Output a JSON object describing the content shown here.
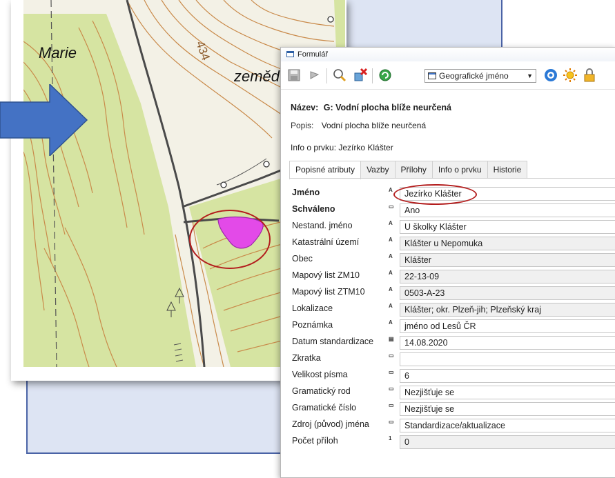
{
  "map": {
    "labels": {
      "place_name": "Marie",
      "land_use": "zeměd.",
      "contour_value": "434"
    }
  },
  "form": {
    "window_title": "Formulář",
    "toolbar": {
      "layer_select_value": "Geografické jméno",
      "icons": [
        "save-icon",
        "undo-icon",
        "search-icon",
        "delete-icon",
        "refresh-icon",
        "layer-icon",
        "target-icon",
        "sun-icon",
        "lock-icon"
      ]
    },
    "nazev": {
      "label": "Název:",
      "value": "G: Vodní plocha blíže neurčená"
    },
    "popis": {
      "label": "Popis:",
      "value": "Vodní plocha blíže neurčená"
    },
    "info": {
      "text": "Info o prvku: Jezírko Klášter"
    },
    "tabs": [
      "Popisné atributy",
      "Vazby",
      "Přílohy",
      "Info o prvku",
      "Historie"
    ],
    "attributes": [
      {
        "label": "Jméno",
        "type": "A",
        "value": "Jezírko Klášter"
      },
      {
        "label": "Schváleno",
        "type": "▭",
        "value": "Ano"
      },
      {
        "label": "Nestand. jméno",
        "type": "A",
        "value": "U školky Klášter"
      },
      {
        "label": "Katastrální území",
        "type": "A",
        "value": "Klášter u Nepomuka"
      },
      {
        "label": "Obec",
        "type": "A",
        "value": "Klášter"
      },
      {
        "label": "Mapový list ZM10",
        "type": "A",
        "value": "22-13-09"
      },
      {
        "label": "Mapový list ZTM10",
        "type": "A",
        "value": "0503-A-23"
      },
      {
        "label": "Lokalizace",
        "type": "A",
        "value": "Klášter; okr. Plzeň-jih; Plzeňský kraj"
      },
      {
        "label": "Poznámka",
        "type": "A",
        "value": "jméno od Lesů ČR"
      },
      {
        "label": "Datum standardizace",
        "type": "▤",
        "value": "14.08.2020"
      },
      {
        "label": "Zkratka",
        "type": "▭",
        "value": ""
      },
      {
        "label": "Velikost písma",
        "type": "▭",
        "value": "6"
      },
      {
        "label": "Gramatický rod",
        "type": "▭",
        "value": "Nezjišťuje se"
      },
      {
        "label": "Gramatické číslo",
        "type": "▭",
        "value": "Nezjišťuje se"
      },
      {
        "label": "Zdroj (původ) jména",
        "type": "▭",
        "value": "Standardizace/aktualizace"
      },
      {
        "label": "Počet příloh",
        "type": "1",
        "value": "0"
      }
    ]
  },
  "colors": {
    "accent_border": "#4a63a6",
    "panel_bg": "#dde4f3",
    "arrow": "#4472c4",
    "highlight_ellipse": "#b31d1d",
    "polygon_fill": "#e34ae8",
    "forest": "#d6e4a2",
    "contour": "#c98a4a"
  }
}
